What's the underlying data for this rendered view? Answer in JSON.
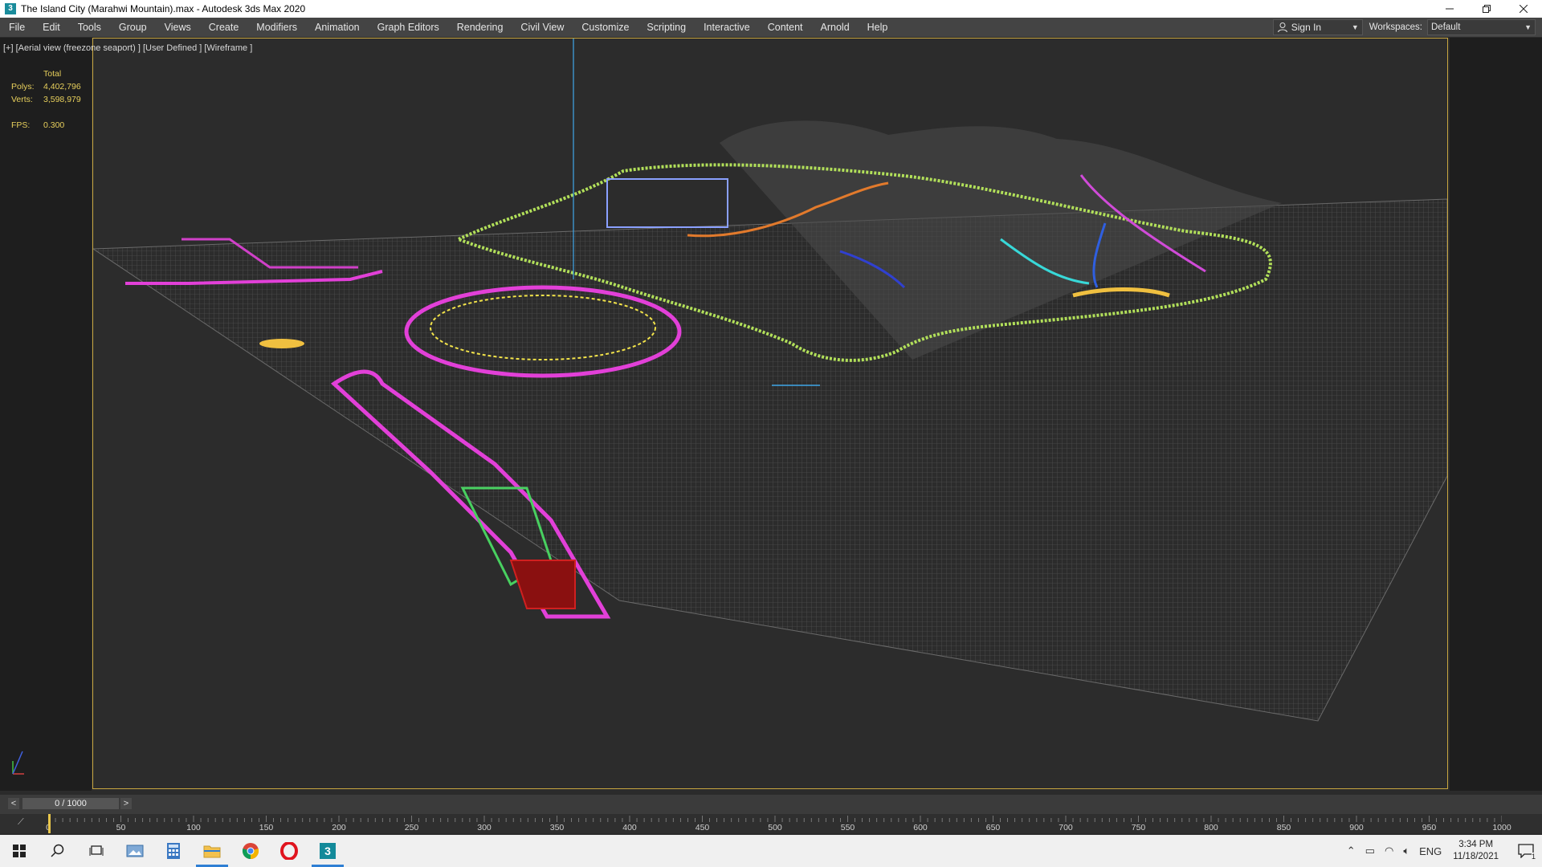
{
  "window": {
    "title": "The Island City (Marahwi Mountain).max - Autodesk 3ds Max 2020",
    "icon_label": "3"
  },
  "menu": {
    "items": [
      "File",
      "Edit",
      "Tools",
      "Group",
      "Views",
      "Create",
      "Modifiers",
      "Animation",
      "Graph Editors",
      "Rendering",
      "Civil View",
      "Customize",
      "Scripting",
      "Interactive",
      "Content",
      "Arnold",
      "Help"
    ],
    "sign_in": "Sign In",
    "workspaces_label": "Workspaces:",
    "workspace_value": "Default"
  },
  "viewport": {
    "label": "[+] [Aerial view (freezone seaport) ] [User Defined ] [Wireframe ]",
    "stats": {
      "total_label": "Total",
      "polys_label": "Polys:",
      "polys_value": "4,402,796",
      "verts_label": "Verts:",
      "verts_value": "3,598,979",
      "fps_label": "FPS:",
      "fps_value": "0.300"
    },
    "border_color": "#c8a640"
  },
  "timeline": {
    "frame_display": "0 / 1000",
    "prev": "<",
    "next": ">",
    "current": 0,
    "end": 1000,
    "tick_labels": [
      "0",
      "50",
      "100",
      "150",
      "200",
      "250",
      "300",
      "350",
      "400",
      "450",
      "500",
      "550",
      "600",
      "650",
      "700",
      "750",
      "800",
      "850",
      "900",
      "950",
      "1000"
    ]
  },
  "taskbar": {
    "lang": "ENG",
    "time": "3:34 PM",
    "date": "11/18/2021",
    "notifications": "1"
  }
}
